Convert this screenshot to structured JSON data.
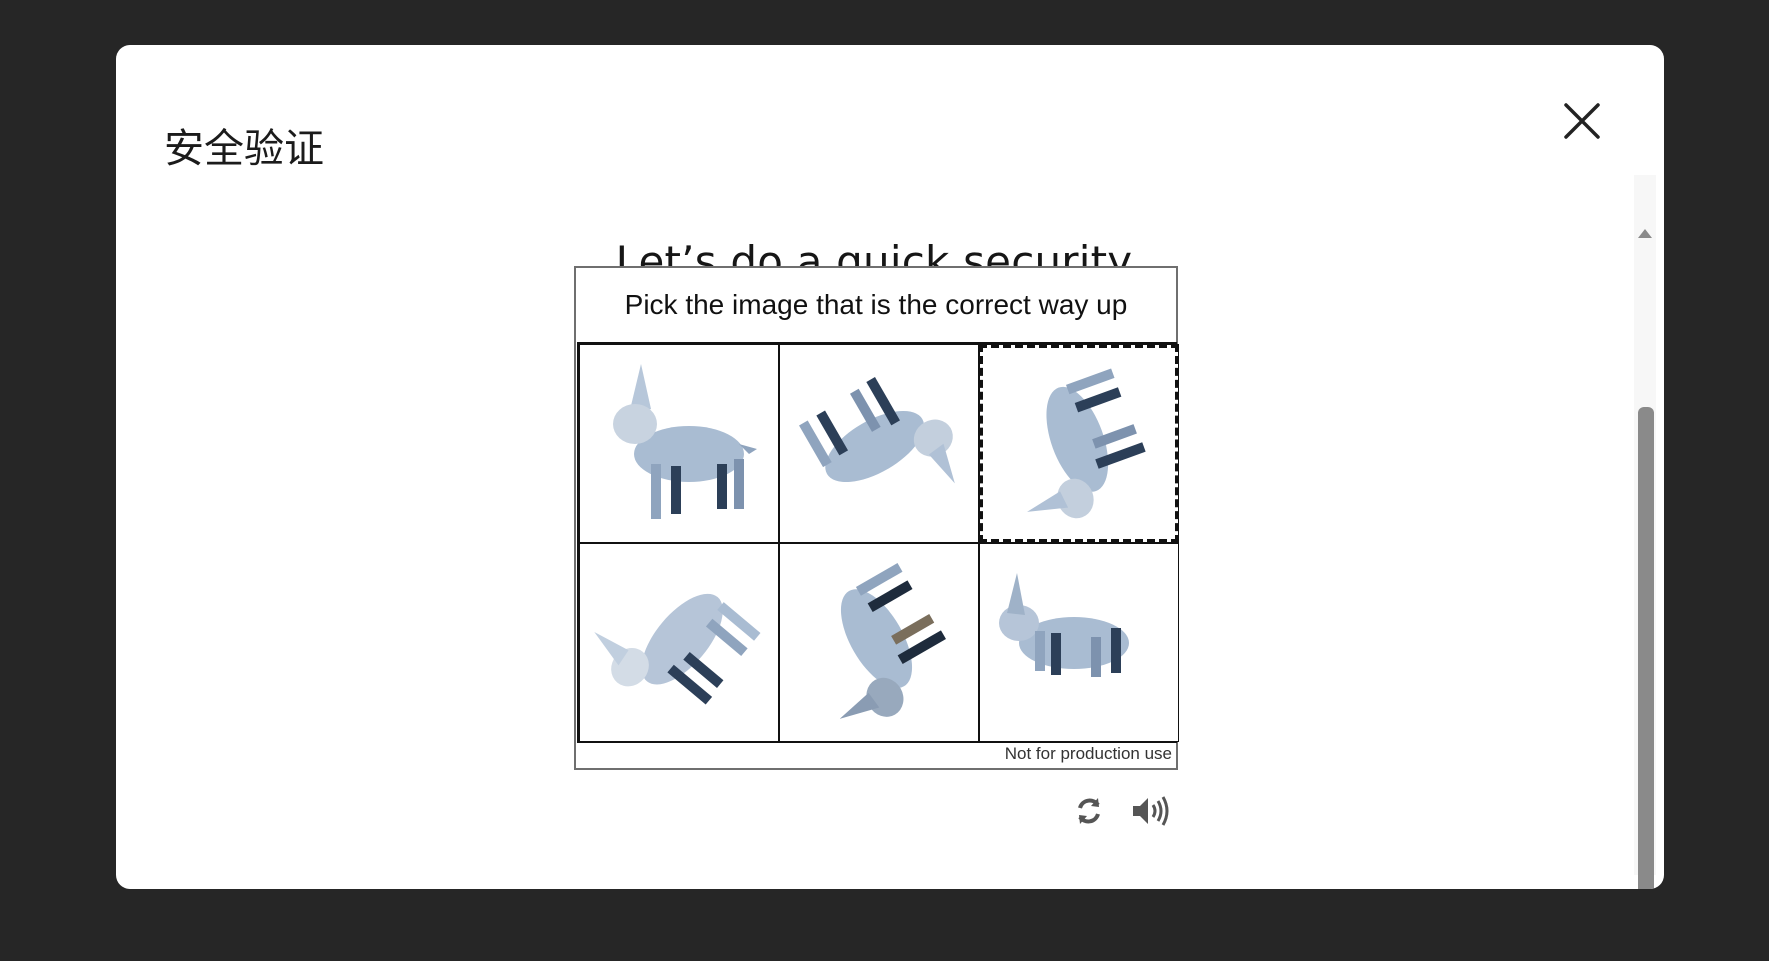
{
  "dialog": {
    "title": "安全验证",
    "close_icon": "close-icon"
  },
  "challenge": {
    "heading": "Let’s do a quick security check",
    "instruction": "Pick the image that is the correct way up",
    "watermark": "Not for production use",
    "tiles": [
      {
        "icon": "dog-upright-image",
        "selected": false
      },
      {
        "icon": "dog-rotated-image",
        "selected": false
      },
      {
        "icon": "dog-rotated-image",
        "selected": true
      },
      {
        "icon": "dog-rotated-image",
        "selected": false
      },
      {
        "icon": "dog-rotated-image",
        "selected": false
      },
      {
        "icon": "dog-rotated-image",
        "selected": false
      }
    ]
  },
  "controls": {
    "refresh_icon": "refresh-icon",
    "audio_icon": "speaker-icon"
  },
  "colors": {
    "overlay": "#262626",
    "dialog_bg": "#ffffff",
    "animal": "#9fb4cc",
    "scroll_thumb": "#8a8a8a"
  }
}
